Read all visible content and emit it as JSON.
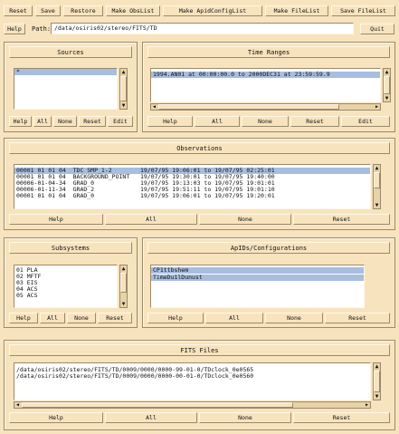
{
  "toolbar": {
    "reset": "Reset",
    "save": "Save",
    "restore": "Restore",
    "make_obslist": "Make ObsList",
    "make_apidconfiglist": "Make ApidConfigList",
    "make_filelist": "Make FileList",
    "save_filelist": "Save FileList"
  },
  "path_bar": {
    "help": "Help",
    "label": "Path:",
    "value": "/data/osiris02/stereo/FITS/TD",
    "quit": "Quit"
  },
  "sources": {
    "title": "Sources",
    "items": [
      "*"
    ],
    "buttons": [
      "Help",
      "All",
      "None",
      "Reset",
      "Edit"
    ]
  },
  "time_ranges": {
    "title": "Time Ranges",
    "items": [
      "1994.AN01 at 00:00:00.0 to 2000DEC31 at 23:59:59.9"
    ],
    "buttons": [
      "Help",
      "All",
      "None",
      "Reset",
      "Edit"
    ]
  },
  "observations": {
    "title": "Observations",
    "rows": [
      "00001 01 01 04  TDC SMP_1-2        19/07/95 19:06:01 to 19/07/95 02:25:01",
      "00001 01 01 04  BACKGROUND_POINT   19/07/95 19:30:01 to 19/07/95 19:40:00",
      "00006-01-04-34  GRAD_0             19/07/95 19:13:03 to 19/07/95 19:01:01",
      "00006-01-11-34  GRAD_2             19/07/95 19:51:11 to 19/07/95 19:01:10",
      "00001 01 01 04  GRAD_0             19/07/95 19:06:01 to 19/07/95 19:20:01"
    ],
    "buttons": [
      "Help",
      "All",
      "None",
      "Reset"
    ]
  },
  "subsystems": {
    "title": "Subsystems",
    "items": [
      "01 PLA",
      "02 MFTF",
      "03 EIS",
      "04 ACS",
      "05 ACS"
    ],
    "buttons": [
      "Help",
      "All",
      "None",
      "Reset"
    ]
  },
  "apids": {
    "title": "ApIDs/Configurations",
    "items": [
      "CP1ttbshem",
      "TimeDu1lDunust"
    ],
    "buttons": [
      "Help",
      "All",
      "None",
      "Reset"
    ]
  },
  "fits_files": {
    "title": "FITS Files",
    "items": [
      "/data/osiris02/stereo/FITS/TD/0009/0000/0000-99-01-0/TDclock_0e0565",
      "/data/osiris02/stereo/FITS/TD/0009/0000/0000-00-01-0/TDclock_0e0560"
    ],
    "buttons": [
      "Help",
      "All",
      "None",
      "Reset"
    ]
  },
  "colors": {
    "background": "#f7e3be",
    "list_background": "#ffffff",
    "selection": "#a8bde0"
  }
}
